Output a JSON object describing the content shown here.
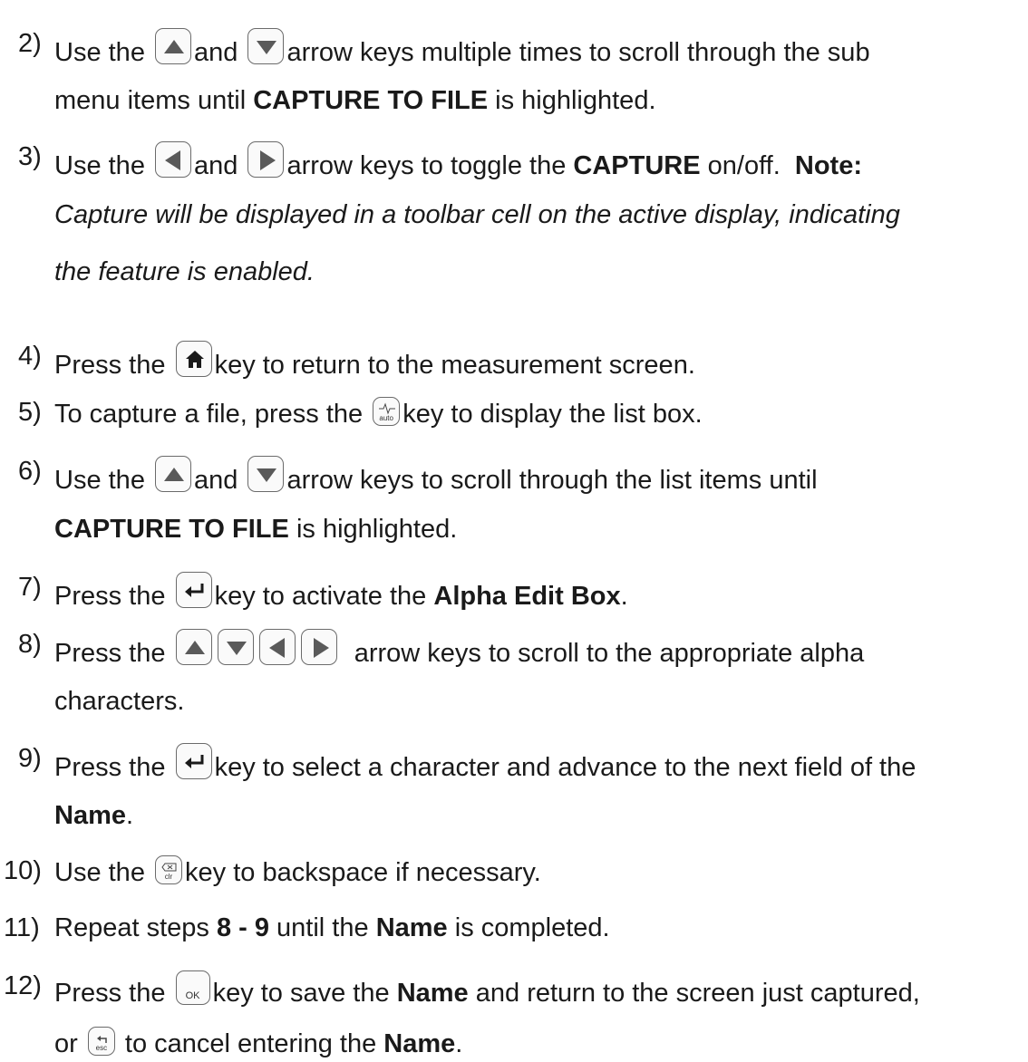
{
  "steps": [
    {
      "num": "2)",
      "a": "Use the",
      "b": "and",
      "c": "arrow keys multiple times to scroll through the sub",
      "cont_a": "menu items until",
      "cont_b": "CAPTURE TO FILE",
      "cont_c": "is highlighted."
    },
    {
      "num": "3)",
      "a": "Use the",
      "b": "and",
      "c": "arrow keys to toggle the",
      "d": "CAPTURE",
      "e": "on/off.",
      "note": "Note:",
      "i1": "Capture will be displayed in a toolbar cell on the active display, indicating",
      "i2": "the feature is enabled."
    },
    {
      "num": "4)",
      "a": "Press the",
      "b": "key to return to the measurement screen."
    },
    {
      "num": "5)",
      "a": "To capture a file, press the",
      "b": "key to display the list box."
    },
    {
      "num": "6)",
      "a": "Use the",
      "b": "and",
      "c": "arrow keys to scroll through the list items until",
      "cont_a": "CAPTURE TO FILE",
      "cont_b": "is highlighted."
    },
    {
      "num": "7)",
      "a": "Press the",
      "b": "key to activate the",
      "c": "Alpha Edit Box",
      "d": "."
    },
    {
      "num": "8)",
      "a": "Press the",
      "b": "arrow keys to scroll to the appropriate alpha",
      "cont_a": "characters."
    },
    {
      "num": "9)",
      "a": "Press the",
      "b": "key to select a character and advance to the next field of the",
      "cont_a": "Name",
      "cont_b": "."
    },
    {
      "num": "10)",
      "a": "Use the",
      "b": "key to backspace if necessary."
    },
    {
      "num": "11)",
      "a": "Repeat steps",
      "b": "8 - 9",
      "c": "until the",
      "d": "Name",
      "e": "is completed."
    },
    {
      "num": "12)",
      "a": "Press the",
      "b": "key to save the",
      "c": "Name",
      "d": "and return to the screen just captured,",
      "cont_a": "or",
      "cont_b": "to cancel entering the",
      "cont_c": "Name",
      "cont_d": "."
    }
  ],
  "keys": {
    "auto": "auto",
    "clr": "clr",
    "ok": "OK",
    "esc": "esc"
  },
  "icons": [
    "up-arrow-key-icon",
    "down-arrow-key-icon",
    "left-arrow-key-icon",
    "right-arrow-key-icon",
    "home-key-icon",
    "auto-key-icon",
    "enter-key-icon",
    "clr-key-icon",
    "ok-key-icon",
    "esc-key-icon"
  ]
}
